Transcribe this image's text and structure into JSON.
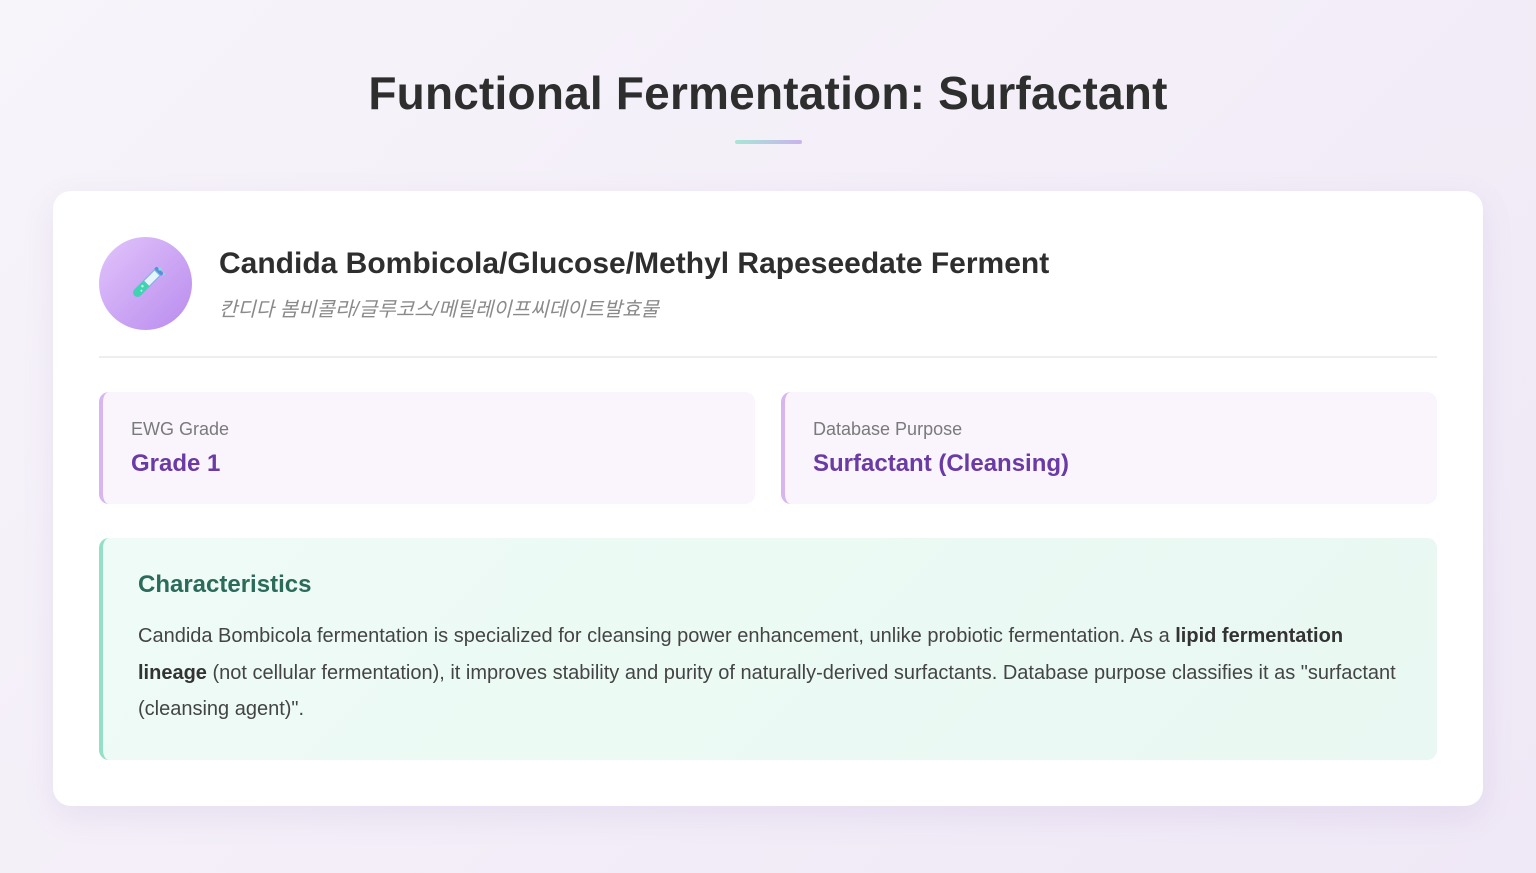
{
  "page": {
    "title": "Functional Fermentation: Surfactant"
  },
  "ingredient": {
    "icon": "test-tube-icon",
    "name": "Candida Bombicola/Glucose/Methyl Rapeseedate Ferment",
    "korean_name": "칸디다 봄비콜라/글루코스/메틸레이프씨데이트발효물"
  },
  "info_cards": [
    {
      "label": "EWG Grade",
      "value": "Grade 1"
    },
    {
      "label": "Database Purpose",
      "value": "Surfactant (Cleansing)"
    }
  ],
  "characteristics": {
    "title": "Characteristics",
    "text_part1": "Candida Bombicola fermentation is specialized for cleansing power enhancement, unlike probiotic fermentation. As a ",
    "text_bold": "lipid fermentation lineage",
    "text_part2": " (not cellular fermentation), it improves stability and purity of naturally-derived surfactants. Database purpose classifies it as \"surfactant (cleansing agent)\"."
  },
  "colors": {
    "accent_purple": "#6a3aa5",
    "accent_green": "#2c6a5a",
    "info_border": "#d7b6ef",
    "characteristics_border": "#94dfc5"
  }
}
